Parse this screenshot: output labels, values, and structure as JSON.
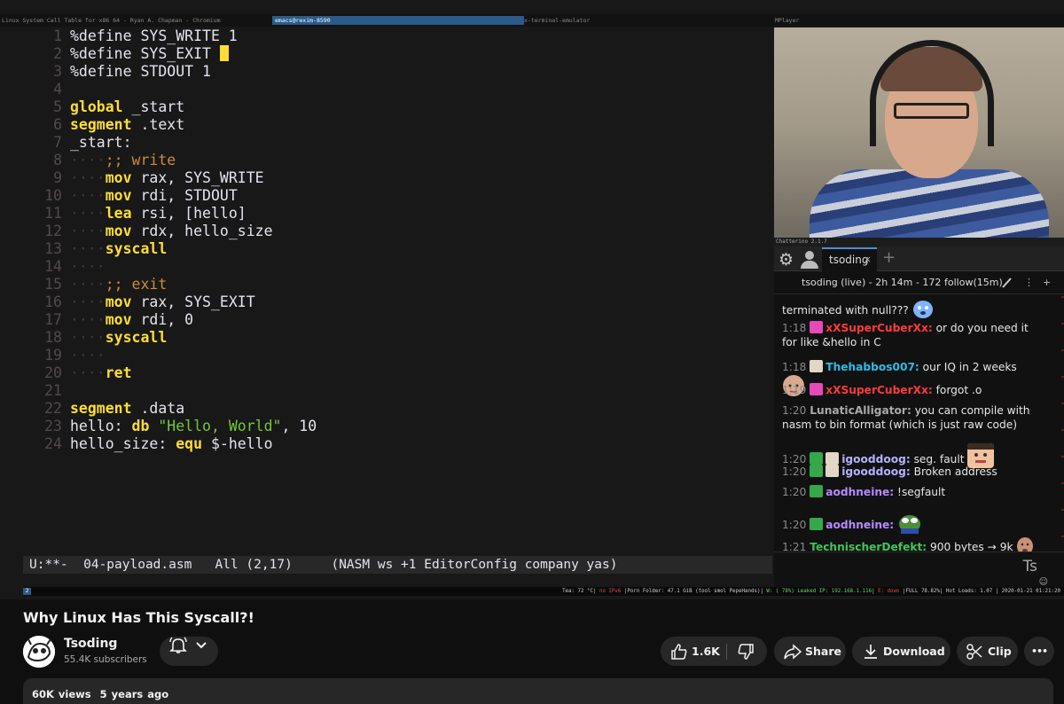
{
  "window_bar": {
    "left_title": "Linux System Call Table for x86 64 - Ryan A. Chapman - Chromium",
    "active_title": "emacs@rexim-8590",
    "terminal_title": "x-terminal-emulator",
    "player_title": "MPlayer"
  },
  "editor": {
    "lines": [
      {
        "n": "1",
        "parts": [
          {
            "c": "pl",
            "t": "%define SYS_WRITE 1"
          }
        ]
      },
      {
        "n": "2",
        "parts": [
          {
            "c": "pl",
            "t": "%define SYS_EXIT "
          }
        ],
        "cursor": true
      },
      {
        "n": "3",
        "parts": [
          {
            "c": "pl",
            "t": "%define STDOUT 1"
          }
        ]
      },
      {
        "n": "4",
        "parts": []
      },
      {
        "n": "5",
        "parts": [
          {
            "c": "kw",
            "t": "global"
          },
          {
            "c": "pl",
            "t": " _start"
          }
        ]
      },
      {
        "n": "6",
        "parts": [
          {
            "c": "kw",
            "t": "segment"
          },
          {
            "c": "pl",
            "t": " .text"
          }
        ]
      },
      {
        "n": "7",
        "parts": [
          {
            "c": "pl",
            "t": "_start:"
          }
        ]
      },
      {
        "n": "8",
        "parts": [
          {
            "c": "ws",
            "t": "····"
          },
          {
            "c": "cm",
            "t": ";; write"
          }
        ]
      },
      {
        "n": "9",
        "parts": [
          {
            "c": "ws",
            "t": "····"
          },
          {
            "c": "kw",
            "t": "mov"
          },
          {
            "c": "pl",
            "t": " rax, SYS_WRITE"
          }
        ]
      },
      {
        "n": "10",
        "parts": [
          {
            "c": "ws",
            "t": "····"
          },
          {
            "c": "kw",
            "t": "mov"
          },
          {
            "c": "pl",
            "t": " rdi, STDOUT"
          }
        ]
      },
      {
        "n": "11",
        "parts": [
          {
            "c": "ws",
            "t": "····"
          },
          {
            "c": "kw",
            "t": "lea"
          },
          {
            "c": "pl",
            "t": " rsi, [hello]"
          }
        ]
      },
      {
        "n": "12",
        "parts": [
          {
            "c": "ws",
            "t": "····"
          },
          {
            "c": "kw",
            "t": "mov"
          },
          {
            "c": "pl",
            "t": " rdx, hello_size"
          }
        ]
      },
      {
        "n": "13",
        "parts": [
          {
            "c": "ws",
            "t": "····"
          },
          {
            "c": "kw",
            "t": "syscall"
          }
        ]
      },
      {
        "n": "14",
        "parts": [
          {
            "c": "ws",
            "t": "····"
          }
        ]
      },
      {
        "n": "15",
        "parts": [
          {
            "c": "ws",
            "t": "····"
          },
          {
            "c": "cm",
            "t": ";; exit"
          }
        ]
      },
      {
        "n": "16",
        "parts": [
          {
            "c": "ws",
            "t": "····"
          },
          {
            "c": "kw",
            "t": "mov"
          },
          {
            "c": "pl",
            "t": " rax, SYS_EXIT"
          }
        ]
      },
      {
        "n": "17",
        "parts": [
          {
            "c": "ws",
            "t": "····"
          },
          {
            "c": "kw",
            "t": "mov"
          },
          {
            "c": "pl",
            "t": " rdi, 0"
          }
        ]
      },
      {
        "n": "18",
        "parts": [
          {
            "c": "ws",
            "t": "····"
          },
          {
            "c": "kw",
            "t": "syscall"
          }
        ]
      },
      {
        "n": "19",
        "parts": [
          {
            "c": "ws",
            "t": "····"
          }
        ]
      },
      {
        "n": "20",
        "parts": [
          {
            "c": "ws",
            "t": "····"
          },
          {
            "c": "kw",
            "t": "ret"
          }
        ]
      },
      {
        "n": "21",
        "parts": []
      },
      {
        "n": "22",
        "parts": [
          {
            "c": "kw",
            "t": "segment"
          },
          {
            "c": "pl",
            "t": " .data"
          }
        ]
      },
      {
        "n": "23",
        "parts": [
          {
            "c": "pl",
            "t": "hello: "
          },
          {
            "c": "kw",
            "t": "db"
          },
          {
            "c": "pl",
            "t": " "
          },
          {
            "c": "st",
            "t": "\"Hello, World\""
          },
          {
            "c": "pl",
            "t": ", 10"
          }
        ]
      },
      {
        "n": "24",
        "parts": [
          {
            "c": "pl",
            "t": "hello_size: "
          },
          {
            "c": "kw",
            "t": "equ"
          },
          {
            "c": "pl",
            "t": " $-hello"
          }
        ]
      }
    ],
    "modeline": "U:**-  04-payload.asm   All (2,17)     (NASM ws +1 EditorConfig company yas)"
  },
  "status_bar": {
    "workspace": "2",
    "tea": "Tea: 72 °C| ",
    "ipv6": "no IPv6",
    "porn": " |Porn Folder: 47.1 GiB (tool smol PepeHands)| ",
    "wifi": "W: ( 78%) Leaked IP: 192.168.1.116",
    "sep": "| ",
    "eth": "E: down",
    "rest": " |FULL 78.82%| Hot Loads: 1.07 | 2020-01-21 01:21:20"
  },
  "chat": {
    "app_title": "Chatterino 2.1.7",
    "tab_label": "tsoding",
    "tab_close": "×",
    "add_tab": "+",
    "live_info": "tsoding (live) - 2h 14m - 172",
    "follow_info": "follow(15m)",
    "input_hint": "Ts",
    "messages": [
      {
        "time": "",
        "badges": [],
        "user": "",
        "color": "#e6e6e6",
        "text": "terminated with null???",
        "emote": "blue-blob"
      },
      {
        "time": "1:18",
        "badges": [
          "heart"
        ],
        "user": "xXSuperCuberXx:",
        "color": "#ff3b3b",
        "text": " or do you need it for like &hello in C",
        "emote": ""
      },
      {
        "time": "1:18",
        "badges": [
          "sub"
        ],
        "user": "Thehabbos007:",
        "color": "#2ebbe8",
        "text": " our IQ in 2 weeks",
        "emote": "bald-head"
      },
      {
        "time": "1:19",
        "badges": [
          "heart"
        ],
        "user": "xXSuperCuberXx:",
        "color": "#ff3b3b",
        "text": " forgot .o",
        "emote": ""
      },
      {
        "time": "1:20",
        "badges": [],
        "user": "LunaticAlligator:",
        "color": "#a9a9a9",
        "text": " you can compile with nasm to bin format (which is just raw code)",
        "emote": ""
      },
      {
        "time": "1:20",
        "badges": [
          "mod",
          "sub"
        ],
        "user": "igooddoog:",
        "color": "#b7b0ff",
        "text": " seg. fault",
        "emote": "face"
      },
      {
        "time": "1:20",
        "badges": [
          "mod",
          "sub"
        ],
        "user": "igooddoog:",
        "color": "#b7b0ff",
        "text": " Broken address",
        "emote": ""
      },
      {
        "time": "1:20",
        "badges": [
          "mod"
        ],
        "user": "aodhneine:",
        "color": "#b58bff",
        "text": " !segfault",
        "emote": ""
      },
      {
        "time": "1:20",
        "badges": [
          "mod"
        ],
        "user": "aodhneine:",
        "color": "#b58bff",
        "text": "",
        "emote": "pepe"
      },
      {
        "time": "1:21",
        "badges": [],
        "user": "TechnischerDefekt:",
        "color": "#3fc45c",
        "text": " 900 bytes → 9k",
        "emote": "small-face"
      }
    ]
  },
  "video": {
    "title": "Why Linux Has This Syscall?!",
    "channel_name": "Tsoding",
    "subscribers": "55.4K subscribers",
    "likes": "1.6K",
    "share_label": "Share",
    "download_label": "Download",
    "clip_label": "Clip",
    "more_label": "•••",
    "views": "60K views",
    "age": "5 years ago"
  }
}
